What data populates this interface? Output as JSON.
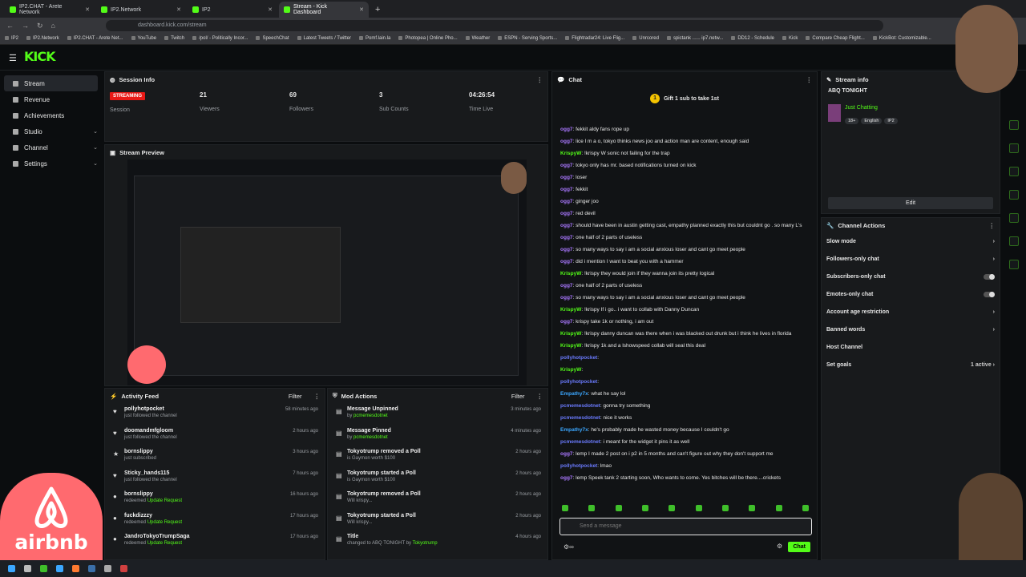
{
  "browser": {
    "tabs": [
      {
        "label": "IP2.CHAT - Arete Network"
      },
      {
        "label": "IP2.Network"
      },
      {
        "label": "IP2"
      },
      {
        "label": "Stream - Kick Dashboard"
      }
    ],
    "url": "dashboard.kick.com/stream",
    "bookmarks": [
      "IP2",
      "IP2.Network",
      "IP2.CHAT - Arete Net...",
      "YouTube",
      "Twitch",
      "/pol/ - Politically Incor...",
      "SpeechChat",
      "Latest Tweets / Twitter",
      "Pomf.lain.la",
      "Photopea | Online Pho...",
      "Weather",
      "ESPN - Serving Sports...",
      "Flightradar24: Live Flig...",
      "Unrcored",
      "spictank ...... ip7.netw...",
      "DD12 - Schedule",
      "Kick",
      "Compare Cheap Flight...",
      "KickBot: Customizable..."
    ]
  },
  "kick": {
    "logo": "KICK"
  },
  "sidebar": {
    "items": [
      {
        "label": "Stream"
      },
      {
        "label": "Revenue"
      },
      {
        "label": "Achievements"
      },
      {
        "label": "Studio"
      },
      {
        "label": "Channel"
      },
      {
        "label": "Settings"
      }
    ]
  },
  "session": {
    "title": "Session Info",
    "status": "STREAMING",
    "session_label": "Session",
    "viewers": "21",
    "viewers_label": "Viewers",
    "followers": "69",
    "followers_label": "Followers",
    "subs": "3",
    "subs_label": "Sub Counts",
    "time": "04:26:54",
    "time_label": "Time Live"
  },
  "preview": {
    "title": "Stream Preview"
  },
  "activity": {
    "title": "Activity Feed",
    "filter": "Filter",
    "items": [
      {
        "name": "pollyhotpocket",
        "sub": "just followed the channel",
        "highlight": "",
        "time": "58 minutes ago"
      },
      {
        "name": "doomandmfgloom",
        "sub": "just followed the channel",
        "highlight": "",
        "time": "2 hours ago"
      },
      {
        "name": "bornslippy",
        "sub": "just subscribed",
        "highlight": "",
        "time": "3 hours ago"
      },
      {
        "name": "Sticky_hands115",
        "sub": "just followed the channel",
        "highlight": "",
        "time": "7 hours ago"
      },
      {
        "name": "bornslippy",
        "sub": "redeemed ",
        "highlight": "Update Request",
        "time": "16 hours ago"
      },
      {
        "name": "fuckdizzzy",
        "sub": "redeemed ",
        "highlight": "Update Request",
        "time": "17 hours ago"
      },
      {
        "name": "JandroTokyoTrumpSaga",
        "sub": "redeemed ",
        "highlight": "Update Request",
        "time": "17 hours ago"
      }
    ]
  },
  "mod": {
    "title": "Mod Actions",
    "filter": "Filter",
    "items": [
      {
        "name": "Message Unpinned",
        "by": "by ",
        "who": "pcmemesdotnet",
        "time": "3 minutes ago"
      },
      {
        "name": "Message Pinned",
        "by": "by ",
        "who": "pcmemesdotnet",
        "time": "4 minutes ago"
      },
      {
        "name": "Tokyotrump removed a Poll",
        "by": "is Gaymon worth $100",
        "who": "",
        "time": "2 hours ago"
      },
      {
        "name": "Tokyotrump started a Poll",
        "by": "is Gaymon worth $100",
        "who": "",
        "time": "2 hours ago"
      },
      {
        "name": "Tokyotrump removed a Poll",
        "by": "Will krispy...",
        "who": "",
        "time": "2 hours ago"
      },
      {
        "name": "Tokyotrump started a Poll",
        "by": "Will krispy...",
        "who": "",
        "time": "2 hours ago"
      },
      {
        "name": "Title",
        "by": "changed to ABQ TONIGHT by ",
        "who": "Tokyotrump",
        "time": "4 hours ago"
      }
    ]
  },
  "chat": {
    "title": "Chat",
    "gift": "Gift 1 sub to take 1st",
    "placeholder": "Send a message",
    "send": "Chat",
    "messages": [
      {
        "u": "ogg7",
        "c": "g",
        "t": "fekkit aldy fans rope up"
      },
      {
        "u": "ogg7",
        "c": "g",
        "t": "lice l m a o, tokyo thinks news joo and action man are content, enough said"
      },
      {
        "u": "KrispyW",
        "c": "k",
        "t": "!krispy W sonic not failing for the trap"
      },
      {
        "u": "ogg7",
        "c": "g",
        "t": "tokyo only has mr. based notifications turned on kick"
      },
      {
        "u": "ogg7",
        "c": "g",
        "t": "loser"
      },
      {
        "u": "ogg7",
        "c": "g",
        "t": "fekkit"
      },
      {
        "u": "ogg7",
        "c": "g",
        "t": "ginger joo"
      },
      {
        "u": "ogg7",
        "c": "g",
        "t": "red devil"
      },
      {
        "u": "ogg7",
        "c": "g",
        "t": "should have been in austin getting cast, empathy planned exactly this but couldnt go . so many L's"
      },
      {
        "u": "ogg7",
        "c": "g",
        "t": "one half of 2 parts of useless"
      },
      {
        "u": "ogg7",
        "c": "g",
        "t": "so many ways to say i am a social anxious loser and cant go meet people"
      },
      {
        "u": "ogg7",
        "c": "g",
        "t": "did i mention I want to beat you with a hammer"
      },
      {
        "u": "KrispyW",
        "c": "k",
        "t": "!krispy they would join if they wanna join its pretty logical"
      },
      {
        "u": "ogg7",
        "c": "g",
        "t": "one half of 2 parts of useless"
      },
      {
        "u": "ogg7",
        "c": "g",
        "t": "so many ways to say i am a social anxious loser and cant go meet people"
      },
      {
        "u": "KrispyW",
        "c": "k",
        "t": "!krispy If i go.. i want to collab with Danny Duncan"
      },
      {
        "u": "ogg7",
        "c": "g",
        "t": "krispy take 1k or nothing, i am out"
      },
      {
        "u": "KrispyW",
        "c": "k",
        "t": "!krispy danny duncan was there when i was blacked out drunk but i think he lives in florida"
      },
      {
        "u": "KrispyW",
        "c": "k",
        "t": "!krispy 1k and a lshowspeed collab will seal this deal"
      },
      {
        "u": "pollyhotpocket",
        "c": "p",
        "t": ""
      },
      {
        "u": "KrispyW",
        "c": "k",
        "t": ""
      },
      {
        "u": "pollyhotpocket",
        "c": "p",
        "t": ""
      },
      {
        "u": "Empathy7x",
        "c": "b",
        "t": "what he say lol"
      },
      {
        "u": "pcmemesdotnet",
        "c": "p",
        "t": "gonna try something"
      },
      {
        "u": "pcmemesdotnet",
        "c": "p",
        "t": "nice it works"
      },
      {
        "u": "Empathy7x",
        "c": "b",
        "t": "he's probably made he wasted money because I couldn't go"
      },
      {
        "u": "pcmemesdotnet",
        "c": "p",
        "t": "i meant for the widget it pins it as well"
      },
      {
        "u": "ogg7",
        "c": "g",
        "t": "lemp I made 2 post on i p2 in 5 months and can't figure out why they don't support me"
      },
      {
        "u": "pollyhotpocket",
        "c": "p",
        "t": "lmao"
      },
      {
        "u": "ogg7",
        "c": "g",
        "t": "lemp Speek tank 2 starting soon, Who wants to come. Yes bitches will be there....crickets"
      }
    ]
  },
  "streaminfo": {
    "title": "Stream info",
    "stream_title": "ABQ TONIGHT",
    "category": "Just Chatting",
    "tags": [
      "18+",
      "English",
      "IP2"
    ],
    "edit": "Edit"
  },
  "actions": {
    "title": "Channel Actions",
    "items": [
      {
        "label": "Slow mode",
        "r": "›"
      },
      {
        "label": "Followers-only chat",
        "r": "›"
      },
      {
        "label": "Subscribers-only chat",
        "r": ""
      },
      {
        "label": "Emotes-only chat",
        "r": ""
      },
      {
        "label": "Account age restriction",
        "r": "›"
      },
      {
        "label": "Banned words",
        "r": "›"
      },
      {
        "label": "Host Channel",
        "r": ""
      },
      {
        "label": "Set goals",
        "r": "1 active  ›"
      }
    ]
  },
  "overlay": {
    "airbnb": "airbnb"
  },
  "colors": {
    "accent": "#53fc18",
    "streaming": "#e91916"
  }
}
